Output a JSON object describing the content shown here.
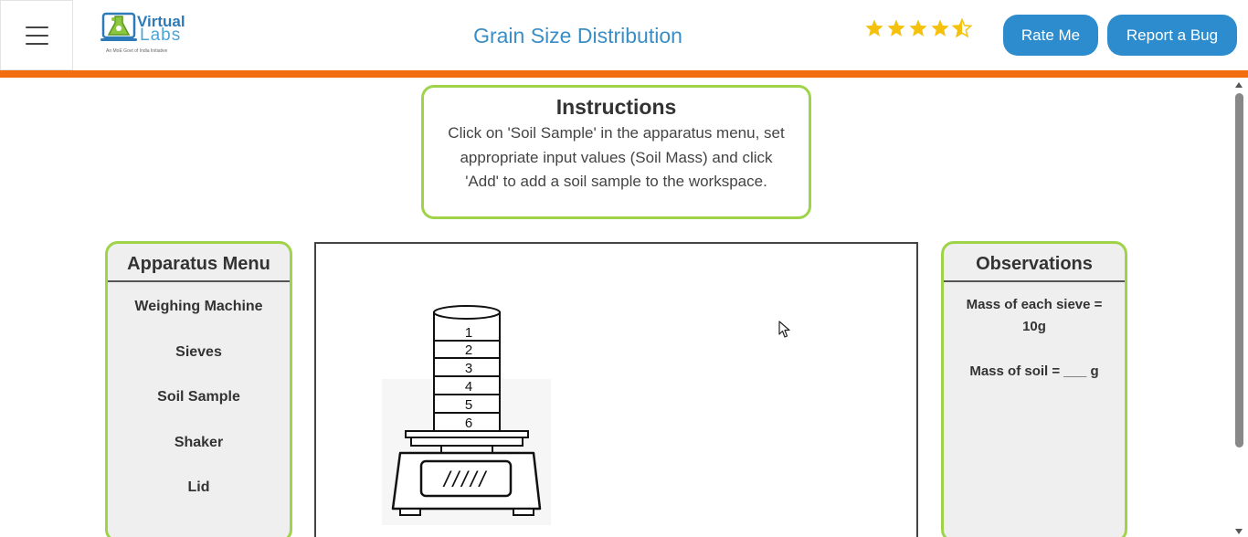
{
  "header": {
    "logo": {
      "line1": "Virtual",
      "line2": "Labs",
      "tagline": "An MoE Govt of India Initiative"
    },
    "title": "Grain Size Distribution",
    "rating": 4.5,
    "rate_button": "Rate Me",
    "bug_button": "Report a Bug"
  },
  "colors": {
    "accent_orange": "#f26d10",
    "primary_blue": "#2d8ccd",
    "panel_border_green": "#9ed34a",
    "star_gold": "#f4c20d"
  },
  "instructions": {
    "title": "Instructions",
    "text": "Click on 'Soil Sample' in the apparatus menu, set appropriate input values (Soil Mass) and click 'Add' to add a soil sample to the workspace."
  },
  "apparatus_menu": {
    "title": "Apparatus Menu",
    "items": [
      "Weighing Machine",
      "Sieves",
      "Soil Sample",
      "Shaker",
      "Lid"
    ]
  },
  "workspace": {
    "sieve_labels": [
      "1",
      "2",
      "3",
      "4",
      "5",
      "6"
    ],
    "scale_display": "/////"
  },
  "observations": {
    "title": "Observations",
    "sieve_mass": "Mass of each sieve = 10g",
    "soil_mass": "Mass of soil = ___ g"
  }
}
